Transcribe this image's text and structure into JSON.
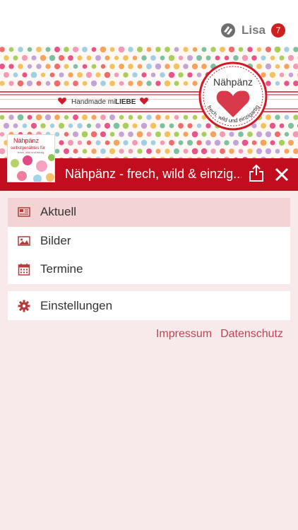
{
  "user": {
    "name": "Lisa",
    "badge_count": "7",
    "logo_icon": "brand-logo-icon"
  },
  "banner": {
    "ribbon_text_prefix": "Handmade mit",
    "ribbon_text_emph": "LIEBE",
    "badge_title": "Nähpänz",
    "badge_tagline": "frech, wild und einzigartig"
  },
  "thumb": {
    "title": "Nähpänz",
    "subtitle": "selbstgenähtes für",
    "small": "frech, wild und einzig"
  },
  "header": {
    "title": "Nähpänz - frech, wild & einzig...",
    "bar_color": "#c10d1e",
    "share_icon": "share-icon",
    "close_icon": "close-icon"
  },
  "menu": {
    "items": [
      {
        "label": "Aktuell",
        "icon": "newspaper-icon",
        "active": true
      },
      {
        "label": "Bilder",
        "icon": "image-icon",
        "active": false
      },
      {
        "label": "Termine",
        "icon": "calendar-icon",
        "active": false
      }
    ],
    "settings": {
      "label": "Einstellungen",
      "icon": "gear-icon"
    }
  },
  "footer_links": {
    "impressum": "Impressum",
    "datenschutz": "Datenschutz"
  },
  "colors": {
    "accent": "#c10d1e",
    "link": "#b5475a",
    "background": "#f8eaea",
    "active_item": "#f3d3d3"
  }
}
